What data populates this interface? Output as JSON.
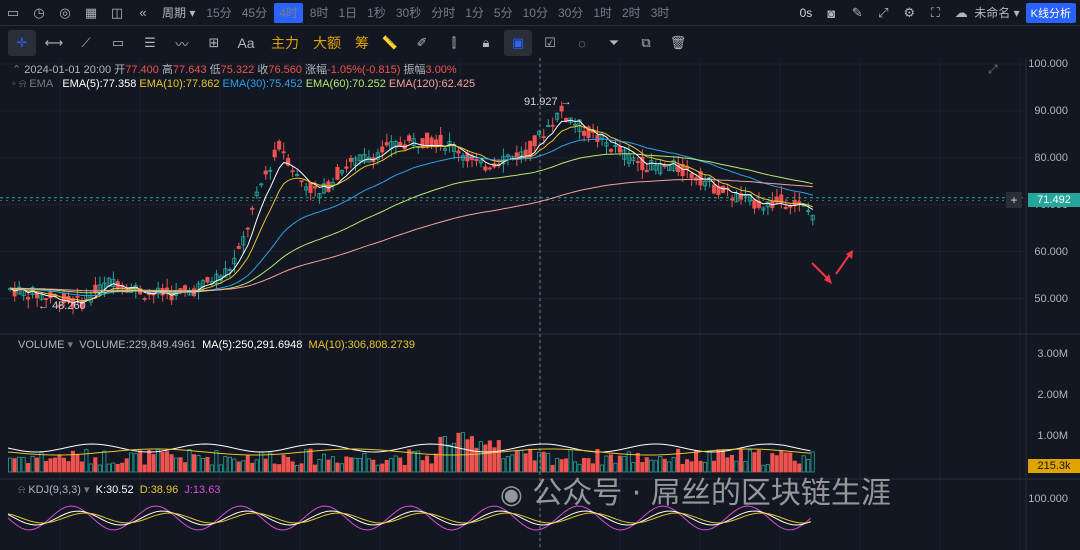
{
  "toolbar": {
    "periods": [
      "15分",
      "45分",
      "4时",
      "8时",
      "1日",
      "1秒",
      "30秒",
      "分时",
      "1分",
      "5分",
      "10分",
      "30分",
      "1时",
      "2时",
      "3时"
    ],
    "active_period": "4时",
    "period_menu_label": "周期",
    "seconds_label": "0s",
    "layout_name": "未命名",
    "kline_analysis_label": "K线分析"
  },
  "drawbar": {
    "text_tool": "Aa",
    "main_force_label": "主力",
    "big_order_label": "大额",
    "chip_label": "筹"
  },
  "ohlc": {
    "date": "2024-01-01 20:00",
    "open_label": "开",
    "open": "77.400",
    "high_label": "高",
    "high": "77.643",
    "low_label": "低",
    "low": "75.322",
    "close_label": "收",
    "close": "76.560",
    "change_label": "涨幅",
    "change": "-1.05%(-0.815)",
    "amp_label": "振幅",
    "amp": "3.00%"
  },
  "ema_legend": {
    "name": "EMA",
    "ema5": "EMA(5):77.358",
    "ema10": "EMA(10):77.862",
    "ema30": "EMA(30):75.452",
    "ema60": "EMA(60):70.252",
    "ema120": "EMA(120):62.425"
  },
  "colors": {
    "ema5": "#ffffff",
    "ema10": "#e7c52f",
    "ema30": "#2ea0e8",
    "ema60": "#b5e86a",
    "ema120": "#f6a29a",
    "up": "#26a69a",
    "down": "#ef5350",
    "price_tag": "#26a69a",
    "volume_tag": "#e0a400",
    "kdj_j": "#d54fd8"
  },
  "price_axis": {
    "ticks": [
      "100.000",
      "90.000",
      "80.000",
      "70.000",
      "60.000",
      "50.000"
    ],
    "current_price": "71.492"
  },
  "annotations": {
    "high_marker": "91.927",
    "low_marker": "48.260"
  },
  "volume_legend": {
    "name": "VOLUME",
    "volume": "VOLUME:229,849.4961",
    "ma5": "MA(5):250,291.6948",
    "ma10": "MA(10):306,808.2739"
  },
  "volume_axis": {
    "ticks": [
      "3.00M",
      "2.00M",
      "1.00M"
    ],
    "current": "215.3k"
  },
  "kdj_legend": {
    "name": "KDJ(9,3,3)",
    "k": "K:30.52",
    "d": "D:38.96",
    "j": "J:13.63"
  },
  "kdj_axis": {
    "ticks": [
      "100.000"
    ]
  },
  "watermark": "公众号 · 屌丝的区块链生涯",
  "chart_data": {
    "type": "candlestick",
    "price_range": [
      45,
      100
    ],
    "ema_last": {
      "ema5": 77.358,
      "ema10": 77.862,
      "ema30": 75.452,
      "ema60": 70.252,
      "ema120": 62.425
    },
    "current_price": 71.492,
    "high": 91.927,
    "low": 48.26,
    "volume_range": [
      0,
      3000000
    ],
    "kdj_last": {
      "k": 30.52,
      "d": 38.96,
      "j": 13.63
    }
  }
}
